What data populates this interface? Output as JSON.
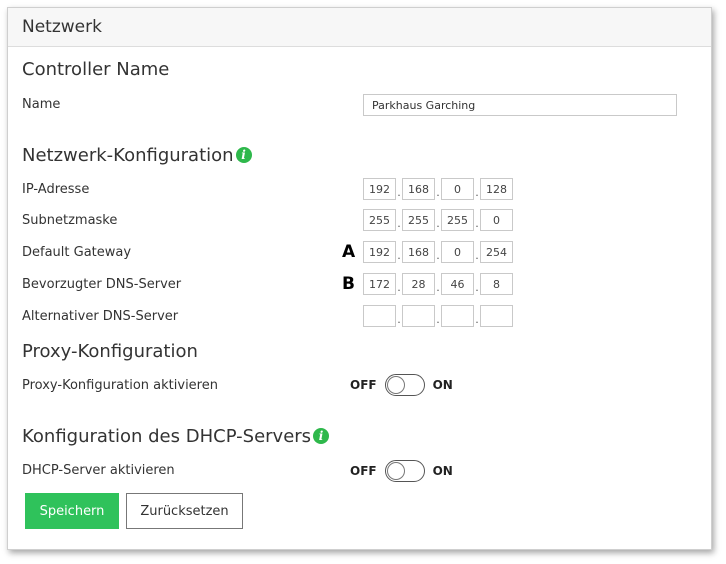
{
  "panel": {
    "title": "Netzwerk"
  },
  "controller": {
    "section_title": "Controller Name",
    "name_label": "Name",
    "name_value": "Parkhaus Garching"
  },
  "network": {
    "section_title": "Netzwerk-Konfiguration",
    "info_icon": "i",
    "rows": [
      {
        "label": "IP-Adresse",
        "octets": [
          "192",
          "168",
          "0",
          "128"
        ],
        "marker": ""
      },
      {
        "label": "Subnetzmaske",
        "octets": [
          "255",
          "255",
          "255",
          "0"
        ],
        "marker": ""
      },
      {
        "label": "Default Gateway",
        "octets": [
          "192",
          "168",
          "0",
          "254"
        ],
        "marker": "A"
      },
      {
        "label": "Bevorzugter DNS-Server",
        "octets": [
          "172",
          "28",
          "46",
          "8"
        ],
        "marker": "B"
      },
      {
        "label": "Alternativer DNS-Server",
        "octets": [
          "",
          "",
          "",
          ""
        ],
        "marker": ""
      }
    ]
  },
  "proxy": {
    "section_title": "Proxy-Konfiguration",
    "toggle_label": "Proxy-Konfiguration aktivieren",
    "off_label": "OFF",
    "on_label": "ON",
    "enabled": false
  },
  "dhcp": {
    "section_title": "Konfiguration des DHCP-Servers",
    "info_icon": "i",
    "toggle_label": "DHCP-Server aktivieren",
    "off_label": "OFF",
    "on_label": "ON",
    "enabled": false
  },
  "buttons": {
    "save": "Speichern",
    "reset": "Zurücksetzen"
  },
  "colors": {
    "primary": "#2fc25b",
    "info": "#2eb84b"
  }
}
